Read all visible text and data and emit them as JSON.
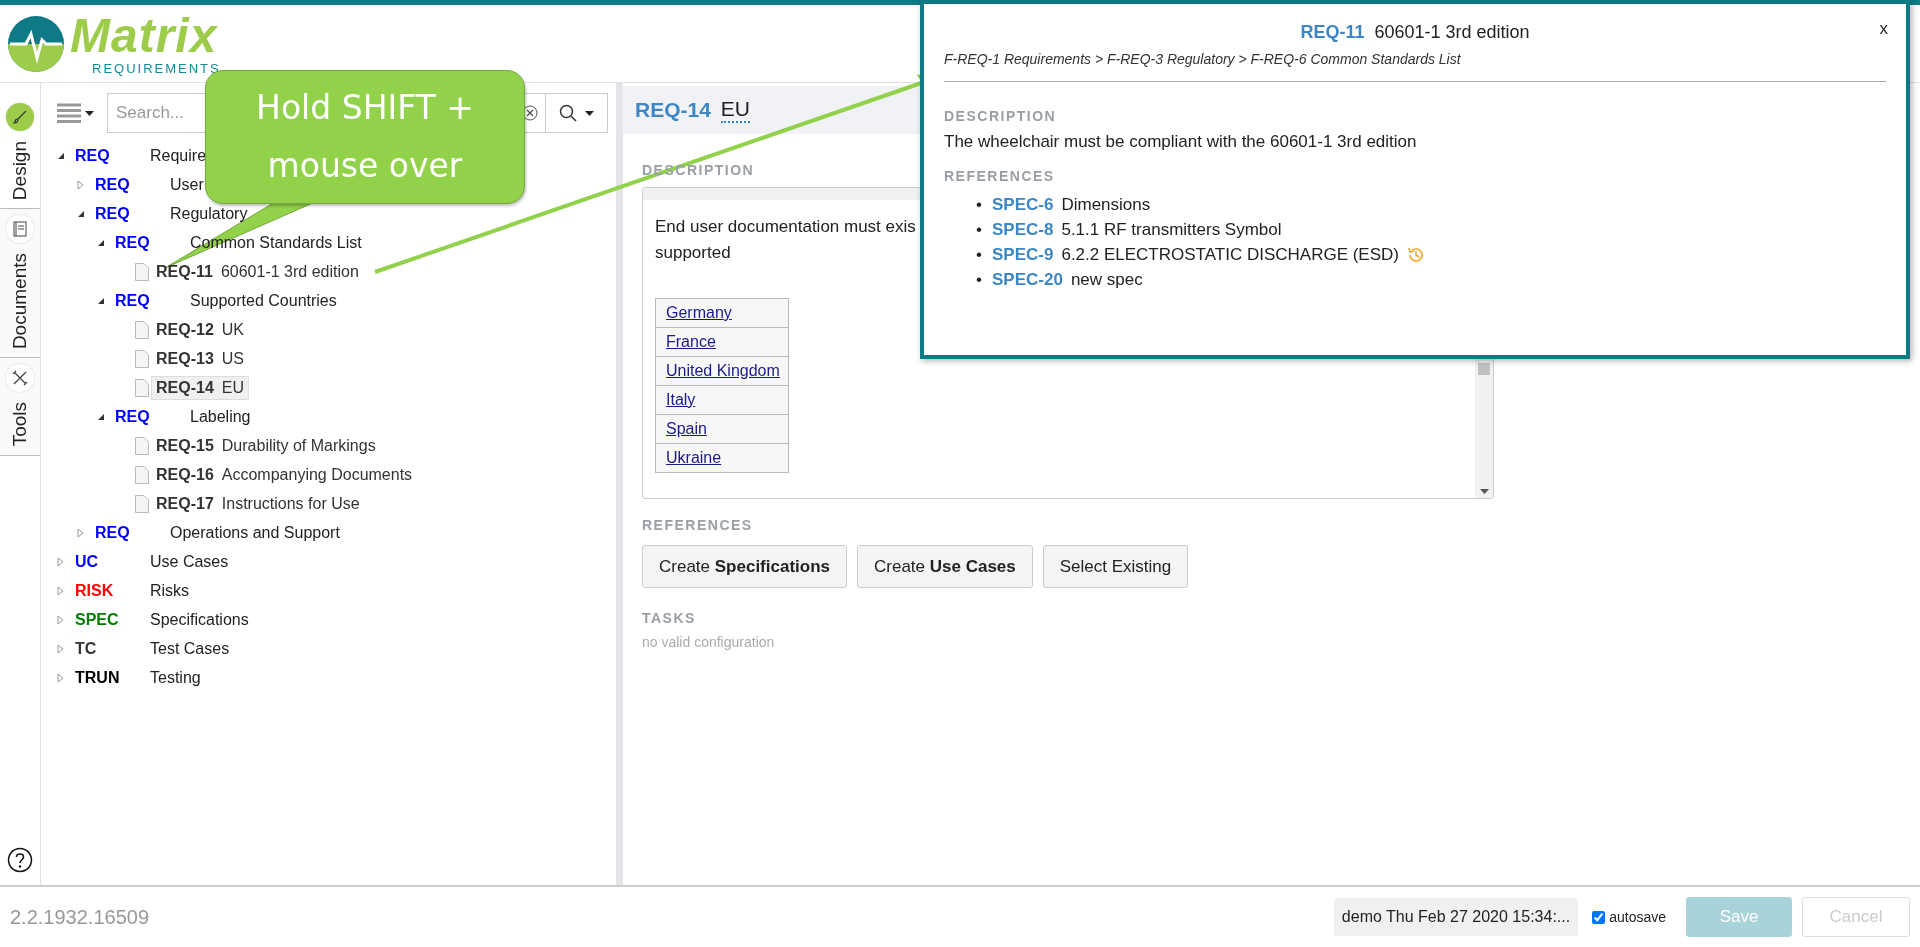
{
  "logo": {
    "name": "Matrix",
    "tagline": "REQUIREMENTS"
  },
  "side_tabs": [
    {
      "label": "Design",
      "selected": true,
      "kind": "design"
    },
    {
      "label": "Documents",
      "selected": false,
      "kind": "documents"
    },
    {
      "label": "Tools",
      "selected": false,
      "kind": "tools"
    }
  ],
  "search": {
    "placeholder": "Search..."
  },
  "tree": [
    {
      "kind": "folder",
      "prefix": "REQ",
      "title": "Require",
      "color": "#0000ff",
      "expanded": true,
      "selected": false,
      "children": [
        {
          "kind": "folder",
          "prefix": "REQ",
          "title": "User",
          "color": "#0000ff",
          "expanded": false,
          "selected": false
        },
        {
          "kind": "folder",
          "prefix": "REQ",
          "title": "Regulatory",
          "color": "#0000ff",
          "expanded": true,
          "selected": false,
          "children": [
            {
              "kind": "folder",
              "prefix": "REQ",
              "title": "Common Standards List",
              "color": "#0000ff",
              "expanded": true,
              "selected": false,
              "children": [
                {
                  "kind": "item",
                  "prefix": "REQ-11",
                  "title": "60601-1 3rd edition",
                  "color": "#333333",
                  "selected": false
                }
              ]
            },
            {
              "kind": "folder",
              "prefix": "REQ",
              "title": "Supported Countries",
              "color": "#0000ff",
              "expanded": true,
              "selected": false,
              "children": [
                {
                  "kind": "item",
                  "prefix": "REQ-12",
                  "title": "UK",
                  "color": "#333333",
                  "selected": false
                },
                {
                  "kind": "item",
                  "prefix": "REQ-13",
                  "title": "US",
                  "color": "#333333",
                  "selected": false
                },
                {
                  "kind": "item",
                  "prefix": "REQ-14",
                  "title": "EU",
                  "color": "#333333",
                  "selected": true
                }
              ]
            },
            {
              "kind": "folder",
              "prefix": "REQ",
              "title": "Labeling",
              "color": "#0000ff",
              "expanded": true,
              "selected": false,
              "children": [
                {
                  "kind": "item",
                  "prefix": "REQ-15",
                  "title": "Durability of Markings",
                  "color": "#333333",
                  "selected": false
                },
                {
                  "kind": "item",
                  "prefix": "REQ-16",
                  "title": "Accompanying Documents",
                  "color": "#333333",
                  "selected": false
                },
                {
                  "kind": "item",
                  "prefix": "REQ-17",
                  "title": "Instructions for Use",
                  "color": "#333333",
                  "selected": false
                }
              ]
            }
          ]
        },
        {
          "kind": "folder",
          "prefix": "REQ",
          "title": "Operations and Support",
          "color": "#0000ff",
          "expanded": false,
          "selected": false
        }
      ]
    },
    {
      "kind": "folder",
      "prefix": "UC",
      "title": "Use Cases",
      "color": "#0000ff",
      "expanded": false,
      "selected": false
    },
    {
      "kind": "folder",
      "prefix": "RISK",
      "title": "Risks",
      "color": "#ff0000",
      "expanded": false,
      "selected": false
    },
    {
      "kind": "folder",
      "prefix": "SPEC",
      "title": "Specifications",
      "color": "#008000",
      "expanded": false,
      "selected": false
    },
    {
      "kind": "folder",
      "prefix": "TC",
      "title": "Test Cases",
      "color": "#333333",
      "expanded": false,
      "selected": false
    },
    {
      "kind": "folder",
      "prefix": "TRUN",
      "title": "Testing",
      "color": "#000000",
      "expanded": false,
      "selected": false
    }
  ],
  "callout": {
    "lines": [
      "Hold SHIFT +",
      "mouse over"
    ]
  },
  "editor": {
    "id": "REQ-14",
    "title": "EU",
    "description_label": "DESCRIPTION",
    "description_lines": [
      "End user documentation must exis",
      "supported"
    ],
    "countries": [
      "Germany",
      "France",
      "United Kingdom",
      "Italy",
      "Spain",
      "Ukraine"
    ],
    "references_label": "REFERENCES",
    "buttons": [
      "Create **Specifications**",
      "Create **Use Cases**",
      "Select Existing"
    ],
    "tasks_label": "TASKS",
    "tasks_text": "no valid configuration"
  },
  "popup": {
    "id": "REQ-11",
    "title": "60601-1 3rd edition",
    "close": "x",
    "breadcrumb": "F-REQ-1 Requirements > F-REQ-3 Regulatory > F-REQ-6 Common Standards List",
    "description_label": "DESCRIPTION",
    "description": "The wheelchair must be compliant with the 60601-1 3rd edition",
    "references_label": "REFERENCES",
    "references": [
      {
        "bullet": "•",
        "id": "SPEC-6",
        "title": "Dimensions",
        "history": false
      },
      {
        "bullet": "•",
        "id": "SPEC-8",
        "title": "5.1.1 RF transmitters Symbol",
        "history": false
      },
      {
        "bullet": "•",
        "id": "SPEC-9",
        "title": "6.2.2 ELECTROSTATIC DISCHARGE (ESD)",
        "history": true
      },
      {
        "bullet": "•",
        "id": "SPEC-20",
        "title": "new spec",
        "history": false
      }
    ]
  },
  "footer": {
    "version": "2.2.1932.16509",
    "session": "demo Thu Feb 27 2020 15:34:...",
    "autosave": {
      "label": "autosave",
      "checked": true
    },
    "buttons": [
      {
        "label": "Save",
        "kind": "primary",
        "disabled": true
      },
      {
        "label": "Cancel",
        "kind": "secondary",
        "disabled": true
      }
    ]
  }
}
